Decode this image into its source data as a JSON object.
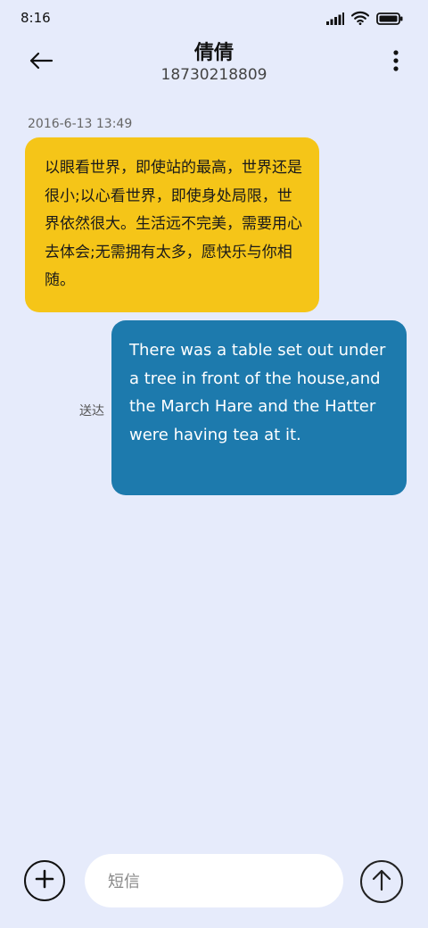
{
  "status_bar": {
    "time": "8:16",
    "icons": [
      "signal-icon",
      "wifi-icon",
      "battery-icon"
    ]
  },
  "header": {
    "back_icon": "arrow-left-icon",
    "contact_name": "倩倩",
    "contact_number": "18730218809",
    "more_icon": "more-vertical-icon"
  },
  "conversation": {
    "timestamp": "2016-6-13 13:49",
    "messages": [
      {
        "direction": "incoming",
        "text": "以眼看世界，即使站的最高，世界还是很小;以心看世界，即使身处局限，世界依然很大。生活远不完美，需要用心去体会;无需拥有太多，愿快乐与你相随。",
        "bubble_color": "#f5c518"
      },
      {
        "direction": "outgoing",
        "text": "There was a table set out under a tree in front of the house,and the March Hare and the Hatter were having tea at it.",
        "status": "送达",
        "bubble_color": "#1d7aad"
      }
    ]
  },
  "compose": {
    "add_icon": "plus-circle-icon",
    "placeholder": "短信",
    "send_icon": "arrow-up-circle-icon"
  },
  "colors": {
    "background": "#e6ebfb",
    "incoming_bubble": "#f5c518",
    "outgoing_bubble": "#1d7aad"
  }
}
